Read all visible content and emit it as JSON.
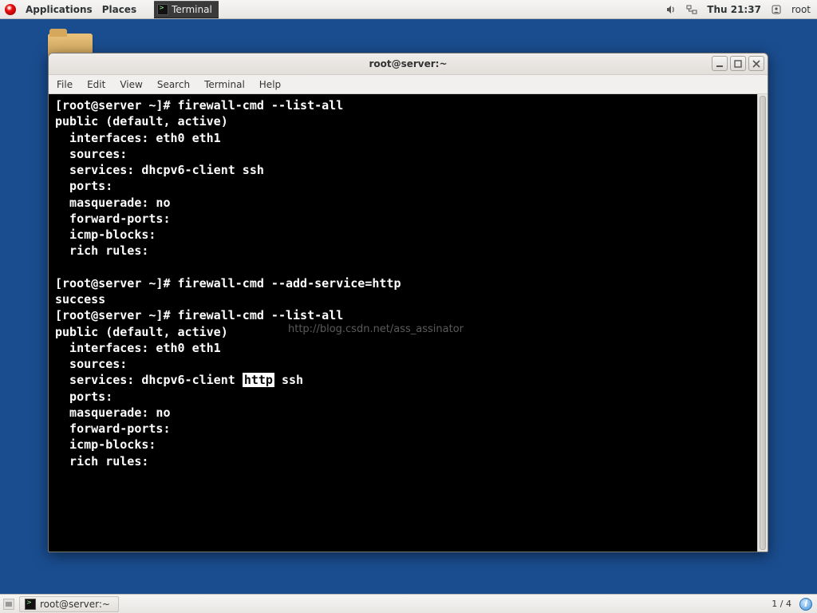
{
  "top_panel": {
    "applications": "Applications",
    "places": "Places",
    "active_task": "Terminal",
    "clock": "Thu 21:37",
    "user": "root"
  },
  "window": {
    "title": "root@server:~",
    "menus": [
      "File",
      "Edit",
      "View",
      "Search",
      "Terminal",
      "Help"
    ]
  },
  "terminal": {
    "prompt": "[root@server ~]# ",
    "cmd1": "firewall-cmd --list-all",
    "out1_l1": "public (default, active)",
    "out1_l2": "  interfaces: eth0 eth1",
    "out1_l3": "  sources:",
    "out1_l4": "  services: dhcpv6-client ssh",
    "out1_l5": "  ports:",
    "out1_l6": "  masquerade: no",
    "out1_l7": "  forward-ports:",
    "out1_l8": "  icmp-blocks:",
    "out1_l9": "  rich rules:",
    "blank": "",
    "cmd2": "firewall-cmd --add-service=http",
    "success": "success",
    "cmd3": "firewall-cmd --list-all",
    "out2_l1": "public (default, active)",
    "out2_l2": "  interfaces: eth0 eth1",
    "out2_l3": "  sources:",
    "out2_l4_pre": "  services: dhcpv6-client ",
    "out2_l4_hl": "http",
    "out2_l4_post": " ssh",
    "out2_l5": "  ports:",
    "out2_l6": "  masquerade: no",
    "out2_l7": "  forward-ports:",
    "out2_l8": "  icmp-blocks:",
    "out2_l9": "  rich rules:",
    "watermark": "http://blog.csdn.net/ass_assinator"
  },
  "bottom_panel": {
    "task": "root@server:~",
    "workspace": "1 / 4"
  }
}
